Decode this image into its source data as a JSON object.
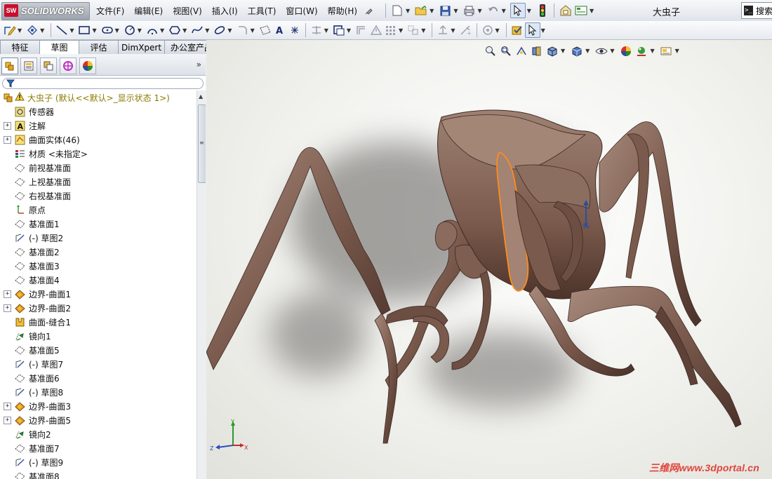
{
  "app": {
    "brand": "SOLIDWORKS",
    "logo_mark": "SW",
    "document_title": "大虫子",
    "search_label": "搜索"
  },
  "menu": [
    "文件(F)",
    "编辑(E)",
    "视图(V)",
    "插入(I)",
    "工具(T)",
    "窗口(W)",
    "帮助(H)"
  ],
  "cm_tabs": [
    {
      "label": "特征",
      "active": false
    },
    {
      "label": "草图",
      "active": true
    },
    {
      "label": "评估",
      "active": false
    },
    {
      "label": "DimXpert",
      "active": false
    },
    {
      "label": "办公室产品",
      "active": false
    }
  ],
  "panel_tabs": [
    "featuremanager-tree-icon",
    "property-manager-icon",
    "configuration-manager-icon",
    "dimxpert-manager-icon",
    "display-manager-icon"
  ],
  "tree": {
    "root": "大虫子  (默认<<默认>_显示状态 1>)",
    "items": [
      {
        "label": "传感器",
        "icon": "sensor-icon",
        "expand": false
      },
      {
        "label": "注解",
        "icon": "annotation-icon",
        "expand": true
      },
      {
        "label": "曲面实体(46)",
        "icon": "surface-bodies-icon",
        "expand": true
      },
      {
        "label": "材质 <未指定>",
        "icon": "material-icon",
        "expand": false
      },
      {
        "label": "前视基准面",
        "icon": "plane-icon",
        "expand": false
      },
      {
        "label": "上视基准面",
        "icon": "plane-icon",
        "expand": false
      },
      {
        "label": "右视基准面",
        "icon": "plane-icon",
        "expand": false
      },
      {
        "label": "原点",
        "icon": "origin-icon",
        "expand": false
      },
      {
        "label": "基准面1",
        "icon": "plane-icon",
        "expand": false
      },
      {
        "label": "(-) 草图2",
        "icon": "sketch-icon",
        "expand": false
      },
      {
        "label": "基准面2",
        "icon": "plane-icon",
        "expand": false
      },
      {
        "label": "基准面3",
        "icon": "plane-icon",
        "expand": false
      },
      {
        "label": "基准面4",
        "icon": "plane-icon",
        "expand": false
      },
      {
        "label": "边界-曲面1",
        "icon": "boundary-surface-icon",
        "expand": true
      },
      {
        "label": "边界-曲面2",
        "icon": "boundary-surface-icon",
        "expand": true
      },
      {
        "label": "曲面-缝合1",
        "icon": "knit-surface-icon",
        "expand": false
      },
      {
        "label": "镜向1",
        "icon": "mirror-icon",
        "expand": false
      },
      {
        "label": "基准面5",
        "icon": "plane-icon",
        "expand": false
      },
      {
        "label": "(-) 草图7",
        "icon": "sketch-icon",
        "expand": false
      },
      {
        "label": "基准面6",
        "icon": "plane-icon",
        "expand": false
      },
      {
        "label": "(-) 草图8",
        "icon": "sketch-icon",
        "expand": false
      },
      {
        "label": "边界-曲面3",
        "icon": "boundary-surface-icon",
        "expand": true
      },
      {
        "label": "边界-曲面5",
        "icon": "boundary-surface-icon",
        "expand": true
      },
      {
        "label": "镜向2",
        "icon": "mirror-icon",
        "expand": false
      },
      {
        "label": "基准面7",
        "icon": "plane-icon",
        "expand": false
      },
      {
        "label": "(-) 草图9",
        "icon": "sketch-icon",
        "expand": false
      },
      {
        "label": "基准面8",
        "icon": "plane-icon",
        "expand": false
      }
    ]
  },
  "triad": {
    "x": "X",
    "y": "Y",
    "z": "Z"
  },
  "watermark": "三维网www.3dportal.cn",
  "colors": {
    "model": "#7a5a4c",
    "accent": "#2a4f9e",
    "highlight": "#ff8c1a"
  }
}
